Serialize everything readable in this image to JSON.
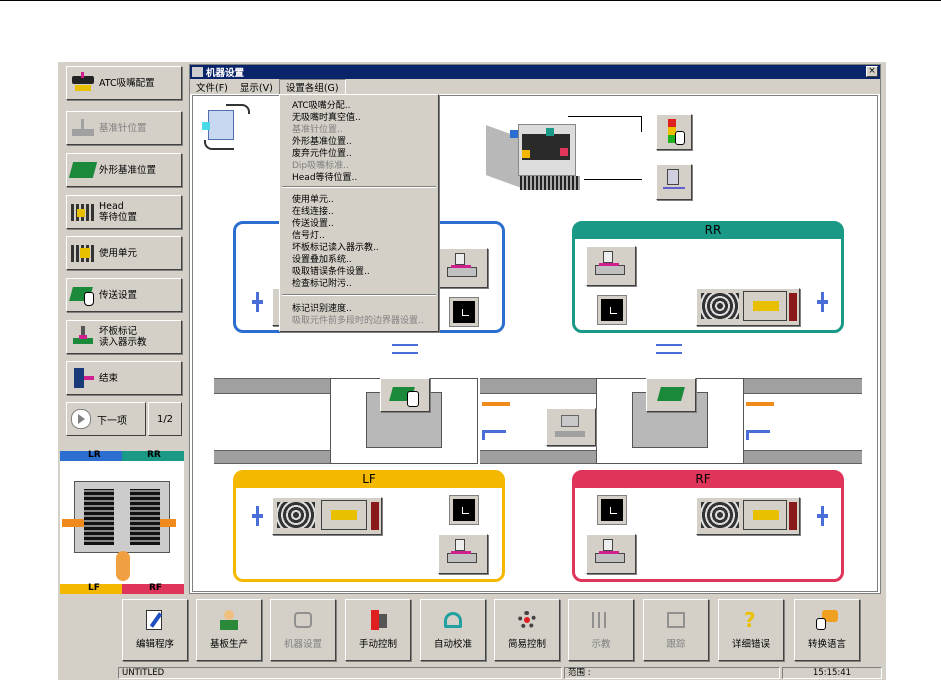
{
  "sidebar": {
    "items": [
      {
        "label": "ATC吸嘴配置",
        "icon": "nozzle-config-icon",
        "enabled": true
      },
      {
        "label": "基准针位置",
        "icon": "pin-position-icon",
        "enabled": false
      },
      {
        "label": "外形基准位置",
        "icon": "board-outline-icon",
        "enabled": true
      },
      {
        "label": "Head\n等待位置",
        "icon": "head-wait-icon",
        "enabled": true
      },
      {
        "label": "使用单元",
        "icon": "unit-icon",
        "enabled": true
      },
      {
        "label": "传送设置",
        "icon": "conveyor-icon",
        "enabled": true
      },
      {
        "label": "坏板标记\n读入器示教",
        "icon": "bad-mark-icon",
        "enabled": true
      },
      {
        "label": "结束",
        "icon": "exit-door-icon",
        "enabled": true
      }
    ],
    "next_label": "下一项",
    "page_label": "1/2"
  },
  "minimap": {
    "lr": "LR",
    "rr": "RR",
    "lf": "LF",
    "rf": "RF"
  },
  "window": {
    "title": "机器设置",
    "close": "×",
    "menu": [
      "文件(F)",
      "显示(V)",
      "设置各组(G)"
    ],
    "dropdown": [
      {
        "label": "ATC吸嘴分配..",
        "enabled": true
      },
      {
        "label": "无吸嘴时真空值..",
        "enabled": true
      },
      {
        "label": "基准针位置..",
        "enabled": false
      },
      {
        "label": "外形基准位置..",
        "enabled": true
      },
      {
        "label": "废弃元件位置..",
        "enabled": true
      },
      {
        "label": "Dip吸嘴标准..",
        "enabled": false
      },
      {
        "label": "Head等待位置..",
        "enabled": true
      },
      {
        "label": "使用单元..",
        "enabled": true
      },
      {
        "label": "在线连接..",
        "enabled": true
      },
      {
        "label": "传送设置..",
        "enabled": true
      },
      {
        "label": "信号灯..",
        "enabled": true
      },
      {
        "label": "坏板标记读入器示教..",
        "enabled": true
      },
      {
        "label": "设置叠加系统..",
        "enabled": true
      },
      {
        "label": "吸取错误条件设置..",
        "enabled": true
      },
      {
        "label": "检查标记附污..",
        "enabled": true
      },
      {
        "label": "标记识别速度..",
        "enabled": true
      },
      {
        "label": "吸取元件前多段时的边界器设置..",
        "enabled": false
      }
    ]
  },
  "panels": {
    "rr": "RR",
    "lf": "LF",
    "rf": "RF"
  },
  "colors": {
    "lr": "#2b6ecf",
    "rr": "#1a9a86",
    "lf": "#f5b800",
    "rf": "#e0355a",
    "title": "#0a246a"
  },
  "toolbar": [
    {
      "label": "编辑程序",
      "icon": "edit-program-icon",
      "enabled": true
    },
    {
      "label": "基板生产",
      "icon": "production-icon",
      "enabled": true
    },
    {
      "label": "机器设置",
      "icon": "machine-setup-icon",
      "enabled": false
    },
    {
      "label": "手动控制",
      "icon": "manual-control-icon",
      "enabled": true
    },
    {
      "label": "自动校准",
      "icon": "auto-calibrate-icon",
      "enabled": true
    },
    {
      "label": "简易控制",
      "icon": "simple-control-icon",
      "enabled": true
    },
    {
      "label": "示教",
      "icon": "teach-icon",
      "enabled": false
    },
    {
      "label": "跟踪",
      "icon": "trace-icon",
      "enabled": false
    },
    {
      "label": "详细错误",
      "icon": "help-icon",
      "enabled": true
    },
    {
      "label": "转换语言",
      "icon": "language-icon",
      "enabled": true
    }
  ],
  "status": {
    "file": "UNTITLED",
    "range": "范围 :",
    "time": "15:15:41"
  }
}
